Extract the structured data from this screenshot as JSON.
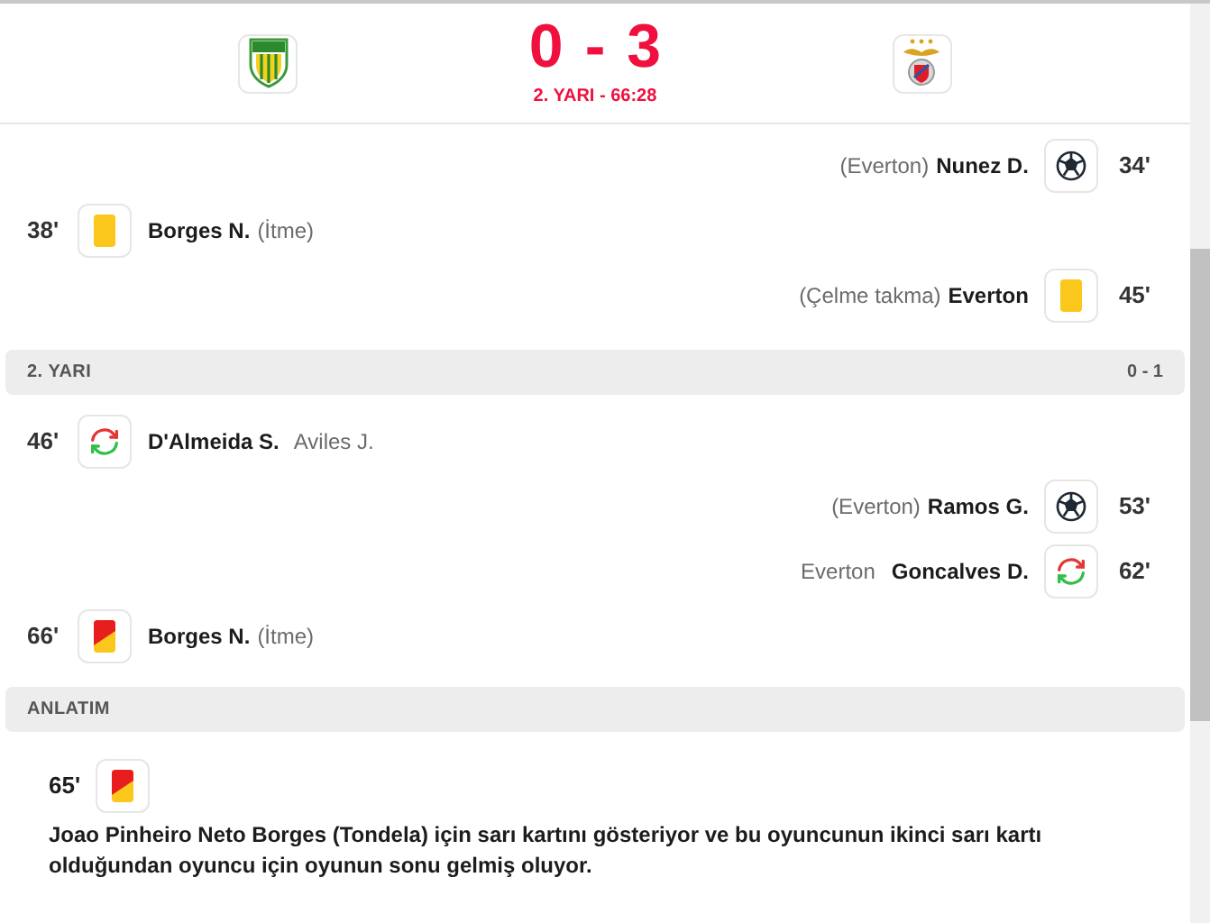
{
  "header": {
    "score_home": "0",
    "score_separator": "-",
    "score_away": "3",
    "status": "2. YARI - 66:28"
  },
  "events_first": [
    {
      "away": true,
      "kind": "goal",
      "minute": "34'",
      "player": "Nunez D.",
      "detail": "(Everton)"
    },
    {
      "away": false,
      "kind": "yellow",
      "minute": "38'",
      "player": "Borges N.",
      "detail": "(İtme)"
    },
    {
      "away": true,
      "kind": "yellow",
      "minute": "45'",
      "player": "Everton",
      "detail": "(Çelme takma)"
    }
  ],
  "second_half": {
    "title": "2. YARI",
    "score": "0 - 1"
  },
  "events_second": [
    {
      "away": false,
      "kind": "sub",
      "minute": "46'",
      "player": "D'Almeida S.",
      "detail": "Aviles J."
    },
    {
      "away": true,
      "kind": "goal",
      "minute": "53'",
      "player": "Ramos G.",
      "detail": "(Everton)"
    },
    {
      "away": true,
      "kind": "sub",
      "minute": "62'",
      "player": "Goncalves D.",
      "detail": "Everton"
    },
    {
      "away": false,
      "kind": "second_yellow",
      "minute": "66'",
      "player": "Borges N.",
      "detail": "(İtme)"
    }
  ],
  "commentary": {
    "title": "ANLATIM",
    "entries": [
      {
        "kind": "second_yellow",
        "minute": "65'",
        "text": "Joao Pinheiro Neto Borges (Tondela) için sarı kartını gösteriyor ve bu oyuncunun ikinci sarı kartı olduğundan oyuncu için oyunun sonu gelmiş oluyor."
      }
    ]
  }
}
